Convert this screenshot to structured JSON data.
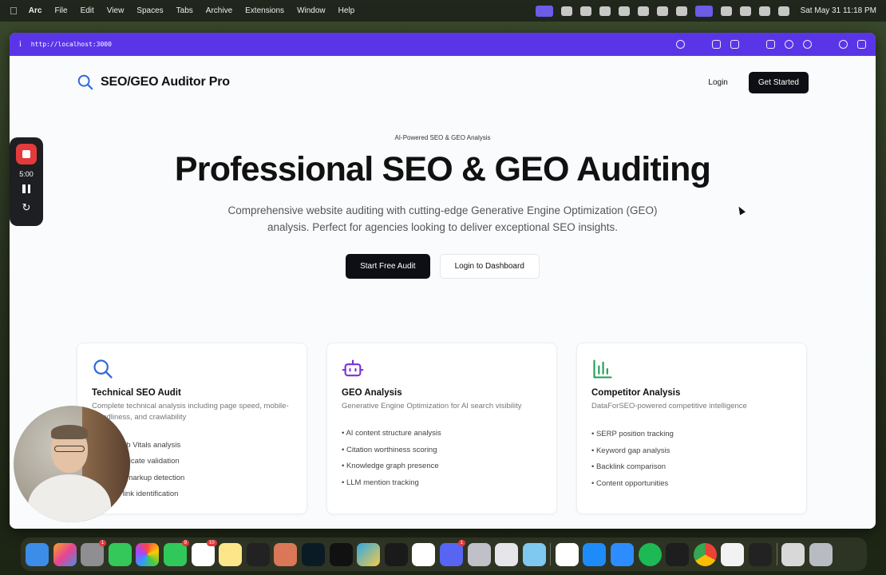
{
  "menubar": {
    "app_name": "Arc",
    "menus": [
      "File",
      "Edit",
      "View",
      "Spaces",
      "Tabs",
      "Archive",
      "Extensions",
      "Window",
      "Help"
    ],
    "clock": "Sat May 31  11:18 PM"
  },
  "browser": {
    "url": "http://localhost:3000",
    "info_glyph": "i"
  },
  "site": {
    "brand": "SEO/GEO Auditor Pro",
    "login": "Login",
    "get_started": "Get Started"
  },
  "hero": {
    "badge": "AI-Powered SEO & GEO Analysis",
    "title": "Professional SEO & GEO Auditing",
    "subtitle": "Comprehensive website auditing with cutting-edge Generative Engine Optimization (GEO) analysis. Perfect for agencies looking to deliver exceptional SEO insights.",
    "primary_cta": "Start Free Audit",
    "secondary_cta": "Login to Dashboard"
  },
  "features": [
    {
      "icon": "search-icon",
      "title": "Technical SEO Audit",
      "description": "Complete technical analysis including page speed, mobile-friendliness, and crawlability",
      "items": [
        "Core Web Vitals analysis",
        "SSL certificate validation",
        "Schema markup detection",
        "Broken link identification"
      ]
    },
    {
      "icon": "bot-icon",
      "title": "GEO Analysis",
      "description": "Generative Engine Optimization for AI search visibility",
      "items": [
        "AI content structure analysis",
        "Citation worthiness scoring",
        "Knowledge graph presence",
        "LLM mention tracking"
      ]
    },
    {
      "icon": "bar-chart-icon",
      "title": "Competitor Analysis",
      "description": "DataForSEO-powered competitive intelligence",
      "items": [
        "SERP position tracking",
        "Keyword gap analysis",
        "Backlink comparison",
        "Content opportunities"
      ]
    }
  ],
  "recorder": {
    "time": "5:00"
  },
  "colors": {
    "brand_blue": "#2f6bd8",
    "geo_purple": "#7b2fd1",
    "competitor_green": "#1f9d55",
    "url_bar": "#5a35e8",
    "dark_button": "#0d0f14",
    "record_red": "#e33b3b"
  },
  "dock": {
    "badges": [
      "1",
      "9",
      "10",
      "1"
    ]
  }
}
